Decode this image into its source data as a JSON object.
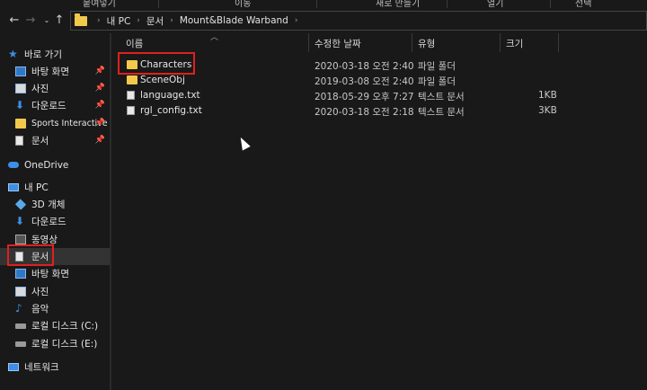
{
  "ribbon": {
    "items": [
      "붙여넣기",
      "이동",
      "새로 만들기",
      "열기",
      "선택"
    ]
  },
  "address_bar": {
    "back_icon": "back-arrow-icon",
    "forward_icon": "forward-arrow-icon",
    "recent_icon": "chevron-down-icon",
    "up_icon": "up-arrow-icon",
    "crumbs": [
      "내 PC",
      "문서",
      "Mount&Blade Warband"
    ]
  },
  "sidebar": {
    "quick_access": "바로 가기",
    "quick_items": [
      {
        "label": "바탕 화면",
        "icon": "desktop-icon",
        "pinned": true
      },
      {
        "label": "사진",
        "icon": "pictures-icon",
        "pinned": true
      },
      {
        "label": "다운로드",
        "icon": "download-icon",
        "pinned": true
      },
      {
        "label": "Sports Interactive",
        "icon": "folder-icon",
        "pinned": true
      },
      {
        "label": "문서",
        "icon": "document-icon",
        "pinned": true
      }
    ],
    "onedrive": "OneDrive",
    "this_pc": "내 PC",
    "pc_items": [
      {
        "label": "3D 개체",
        "icon": "3d-objects-icon"
      },
      {
        "label": "다운로드",
        "icon": "download-icon"
      },
      {
        "label": "동영상",
        "icon": "videos-icon"
      },
      {
        "label": "문서",
        "icon": "document-icon",
        "selected": true
      },
      {
        "label": "바탕 화면",
        "icon": "desktop-icon"
      },
      {
        "label": "사진",
        "icon": "pictures-icon"
      },
      {
        "label": "음악",
        "icon": "music-icon"
      },
      {
        "label": "로컬 디스크 (C:)",
        "icon": "drive-icon"
      },
      {
        "label": "로컬 디스크 (E:)",
        "icon": "drive-icon"
      }
    ],
    "network": "네트워크"
  },
  "columns": {
    "name": "이름",
    "modified": "수정한 날짜",
    "type": "유형",
    "size": "크기"
  },
  "files": [
    {
      "name": "Characters",
      "modified": "2020-03-18 오전 2:40",
      "type": "파일 폴더",
      "size": "",
      "icon": "folder-icon"
    },
    {
      "name": "SceneObj",
      "modified": "2019-03-08 오전 2:40",
      "type": "파일 폴더",
      "size": "",
      "icon": "folder-icon"
    },
    {
      "name": "language.txt",
      "modified": "2018-05-29 오후 7:27",
      "type": "텍스트 문서",
      "size": "1KB",
      "icon": "text-file-icon"
    },
    {
      "name": "rgl_config.txt",
      "modified": "2020-03-18 오전 2:18",
      "type": "텍스트 문서",
      "size": "3KB",
      "icon": "text-file-icon"
    }
  ],
  "highlight_color": "#e02020"
}
